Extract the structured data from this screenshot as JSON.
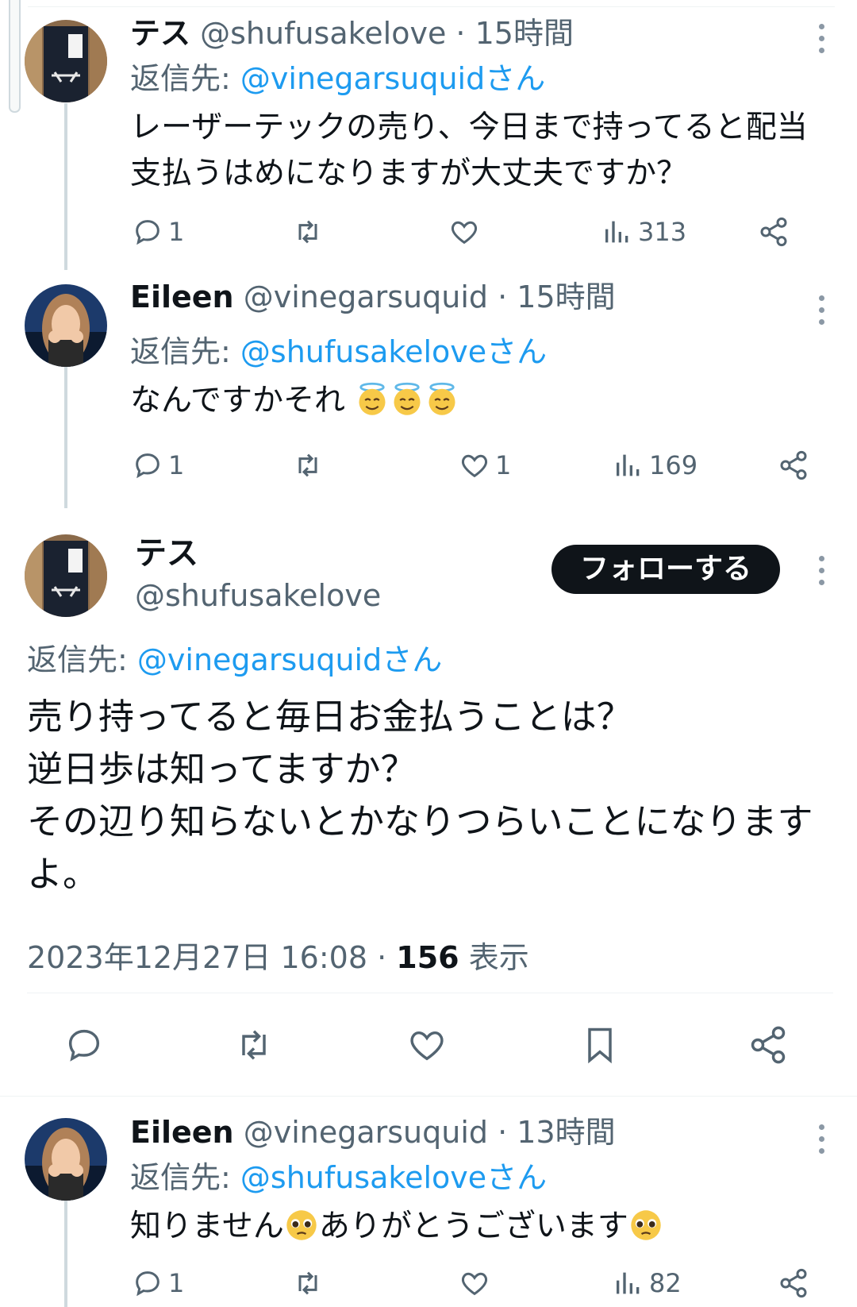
{
  "colors": {
    "text": "#0f1419",
    "muted": "#536471",
    "link": "#1d9bf0",
    "divider": "#eff3f4",
    "thread": "#cfd9de"
  },
  "tweets": [
    {
      "name": "テス",
      "handle": "@shufusakelove",
      "dot": "·",
      "time": "15時間",
      "reply_prefix": "返信先:",
      "reply_to": "@vinegarsuquidさん",
      "text": "レーザーテックの売り、今日まで持ってると配当支払うはめになりますが大丈夫ですか？",
      "replies": "1",
      "retweets": "",
      "likes": "",
      "views": "313"
    },
    {
      "name": "Eileen",
      "handle": "@vinegarsuquid",
      "dot": "·",
      "time": "15時間",
      "reply_prefix": "返信先:",
      "reply_to": "@shufusakeloveさん",
      "text": "なんですかそれ",
      "emoji": "smiling-face-with-halo-emoji",
      "replies": "1",
      "retweets": "",
      "likes": "1",
      "views": "169"
    },
    {
      "name": "Eileen",
      "handle": "@vinegarsuquid",
      "dot": "·",
      "time": "13時間",
      "reply_prefix": "返信先:",
      "reply_to": "@shufusakeloveさん",
      "text_a": "知りません",
      "text_b": "ありがとうございます",
      "emoji": "pleading-face-emoji",
      "replies": "1",
      "retweets": "",
      "likes": "",
      "views": "82"
    }
  ],
  "focus": {
    "name": "テス",
    "handle": "@shufusakelove",
    "follow_label": "フォローする",
    "reply_prefix": "返信先:",
    "reply_to": "@vinegarsuquidさん",
    "text": "売り持ってると毎日お金払うことは？\n逆日歩は知ってますか？\nその辺り知らないとかなりつらいことになりますよ。",
    "timestamp": "2023年12月27日 16:08",
    "dot": "·",
    "views_count": "156",
    "views_label": "表示"
  },
  "icons": [
    "reply-icon",
    "retweet-icon",
    "like-icon",
    "views-icon",
    "share-icon",
    "bookmark-icon",
    "more-icon"
  ]
}
